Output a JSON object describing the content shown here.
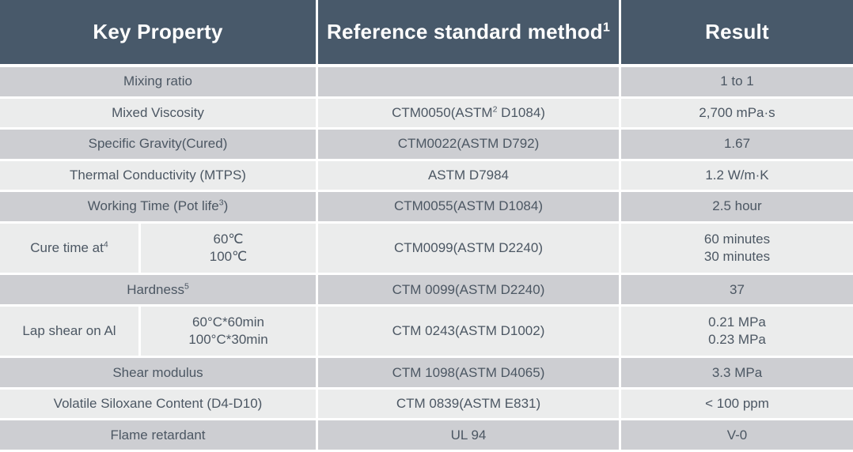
{
  "table": {
    "headers": {
      "key_property": "Key Property",
      "reference_standard_method": "Reference standard method",
      "reference_standard_method_superscript": "1",
      "result": "Result"
    },
    "rows": [
      {
        "key_property": "Mixing ratio",
        "key_property_superscript": "",
        "sub_label": "",
        "reference": "",
        "reference_superscript": "",
        "reference_tail": "",
        "result": "1 to 1",
        "band": "dark",
        "split": false
      },
      {
        "key_property": "Mixed Viscosity",
        "key_property_superscript": "",
        "sub_label": "",
        "reference": "CTM0050(ASTM",
        "reference_superscript": "2",
        "reference_tail": " D1084)",
        "result": "2,700 mPa·s",
        "band": "light",
        "split": false
      },
      {
        "key_property": "Specific Gravity(Cured)",
        "key_property_superscript": "",
        "sub_label": "",
        "reference": "CTM0022(ASTM D792)",
        "reference_superscript": "",
        "reference_tail": "",
        "result": "1.67",
        "band": "dark",
        "split": false
      },
      {
        "key_property": "Thermal Conductivity (MTPS)",
        "key_property_superscript": "",
        "sub_label": "",
        "reference": "ASTM D7984",
        "reference_superscript": "",
        "reference_tail": "",
        "result": "1.2 W/m·K",
        "band": "light",
        "split": false
      },
      {
        "key_property": "Working Time (Pot life",
        "key_property_superscript": "3",
        "key_property_tail": ")",
        "sub_label": "",
        "reference": "CTM0055(ASTM D1084)",
        "reference_superscript": "",
        "reference_tail": "",
        "result": "2.5 hour",
        "band": "dark",
        "split": false
      },
      {
        "key_property": "Cure time at",
        "key_property_superscript": "4",
        "key_property_tail": "",
        "sub_label": "60℃\n100℃",
        "reference": "CTM0099(ASTM D2240)",
        "reference_superscript": "",
        "reference_tail": "",
        "result": "60 minutes\n30 minutes",
        "band": "light",
        "split": true
      },
      {
        "key_property": "Hardness",
        "key_property_superscript": "5",
        "key_property_tail": "",
        "sub_label": "",
        "reference": "CTM 0099(ASTM D2240)",
        "reference_superscript": "",
        "reference_tail": "",
        "result": "37",
        "band": "dark",
        "split": false
      },
      {
        "key_property": "Lap shear on Al",
        "key_property_superscript": "",
        "key_property_tail": "",
        "sub_label": "60°C*60min\n100°C*30min",
        "reference": "CTM 0243(ASTM D1002)",
        "reference_superscript": "",
        "reference_tail": "",
        "result": "0.21 MPa\n0.23 MPa",
        "band": "light",
        "split": true
      },
      {
        "key_property": "Shear modulus",
        "key_property_superscript": "",
        "sub_label": "",
        "reference": "CTM 1098(ASTM D4065)",
        "reference_superscript": "",
        "reference_tail": "",
        "result": "3.3 MPa",
        "band": "dark",
        "split": false
      },
      {
        "key_property": "Volatile Siloxane Content (D4-D10)",
        "key_property_superscript": "",
        "sub_label": "",
        "reference": "CTM 0839(ASTM E831)",
        "reference_superscript": "",
        "reference_tail": "",
        "result": "< 100 ppm",
        "band": "light",
        "split": false
      },
      {
        "key_property": "Flame retardant",
        "key_property_superscript": "",
        "sub_label": "",
        "reference": "UL 94",
        "reference_superscript": "",
        "reference_tail": "",
        "result": "V-0",
        "band": "dark",
        "split": false
      }
    ]
  },
  "colors": {
    "header_background": "#48596a",
    "header_text": "#ffffff",
    "row_dark": "#cdced2",
    "row_light": "#ebecec",
    "body_text": "#4c5763",
    "grid_line": "#ffffff"
  }
}
